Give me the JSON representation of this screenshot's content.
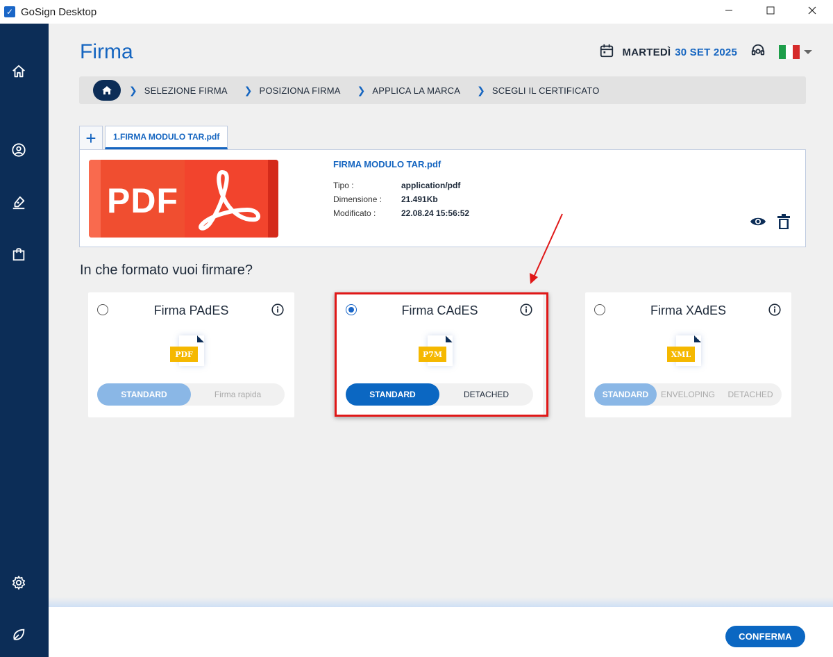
{
  "window": {
    "title": "GoSign Desktop"
  },
  "header": {
    "title": "Firma",
    "weekday": "MARTEDÌ",
    "date": "30 SET 2025"
  },
  "breadcrumb": {
    "items": [
      "SELEZIONE FIRMA",
      "POSIZIONA FIRMA",
      "APPLICA LA MARCA",
      "SCEGLI IL CERTIFICATO"
    ]
  },
  "tabs": {
    "add_label": "+",
    "file_tab": "1.FIRMA MODULO TAR.pdf"
  },
  "file": {
    "thumbnail_text": "PDF",
    "name": "FIRMA MODULO TAR.pdf",
    "meta": [
      {
        "label": "Tipo :",
        "value": "application/pdf"
      },
      {
        "label": "Dimensione :",
        "value": "21.491Kb"
      },
      {
        "label": "Modificato :",
        "value": "22.08.24 15:56:52"
      }
    ]
  },
  "formats": {
    "question": "In che formato vuoi firmare?",
    "cards": [
      {
        "title": "Firma PAdES",
        "badge": "PDF",
        "selected": false,
        "options": [
          "STANDARD",
          "Firma rapida"
        ],
        "active_option": "STANDARD"
      },
      {
        "title": "Firma CAdES",
        "badge": "P7M",
        "selected": true,
        "options": [
          "STANDARD",
          "DETACHED"
        ],
        "active_option": "STANDARD"
      },
      {
        "title": "Firma XAdES",
        "badge": "XML",
        "selected": false,
        "options": [
          "STANDARD",
          "ENVELOPING",
          "DETACHED"
        ],
        "active_option": "STANDARD"
      }
    ]
  },
  "footer": {
    "confirm_label": "CONFERMA"
  },
  "colors": {
    "sidebar": "#0c2d57",
    "accent": "#1565c0",
    "annotation": "#e01818"
  }
}
